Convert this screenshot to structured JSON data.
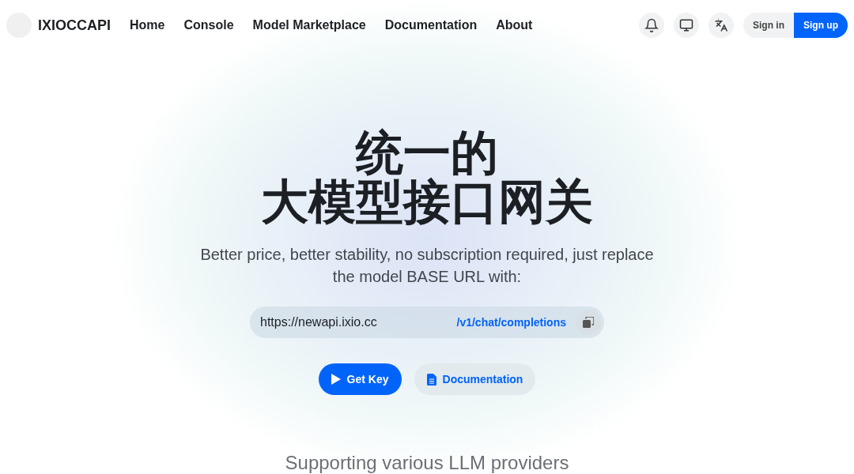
{
  "brand": {
    "name": "IXIOCCAPI"
  },
  "nav": [
    {
      "label": "Home"
    },
    {
      "label": "Console"
    },
    {
      "label": "Model Marketplace"
    },
    {
      "label": "Documentation"
    },
    {
      "label": "About"
    }
  ],
  "auth": {
    "sign_in": "Sign in",
    "sign_up": "Sign up"
  },
  "hero": {
    "title_line_1": "统一的",
    "title_line_2": "大模型接口网关",
    "subtitle": "Better price, better stability, no subscription required, just replace the model BASE URL with:",
    "base_url": "https://newapi.ixio.cc",
    "endpoint": "/v1/chat/completions",
    "primary_button": "Get Key",
    "secondary_button": "Documentation"
  },
  "providers_heading": "Supporting various LLM providers"
}
